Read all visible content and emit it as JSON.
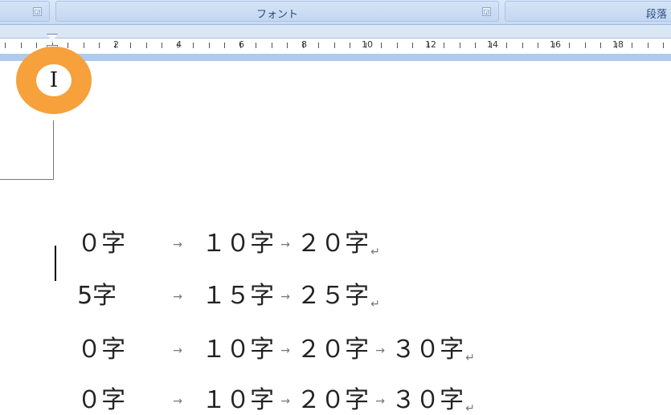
{
  "ribbon": {
    "font_group_label": "フォント",
    "paragraph_group_label": "段落",
    "launcher_icon": "dialog-launcher-icon"
  },
  "ruler": {
    "numbers": [
      "2",
      "4",
      "6",
      "8",
      "10",
      "12",
      "14",
      "16",
      "18"
    ]
  },
  "cursor_icon": "i-beam-cursor-icon",
  "cursor_glyph": "I",
  "tab_glyph": "→",
  "paragraph_mark": "↵",
  "document": {
    "lines": [
      {
        "segments": [
          "０字",
          "１０字",
          "２０字"
        ]
      },
      {
        "segments": [
          "5字",
          "１５字",
          "２５字"
        ]
      },
      {
        "segments": [
          "０字",
          "１０字",
          "２０字",
          "３０字"
        ]
      },
      {
        "segments": [
          "０字",
          "１０字",
          "２０字",
          "３０字"
        ]
      }
    ]
  }
}
